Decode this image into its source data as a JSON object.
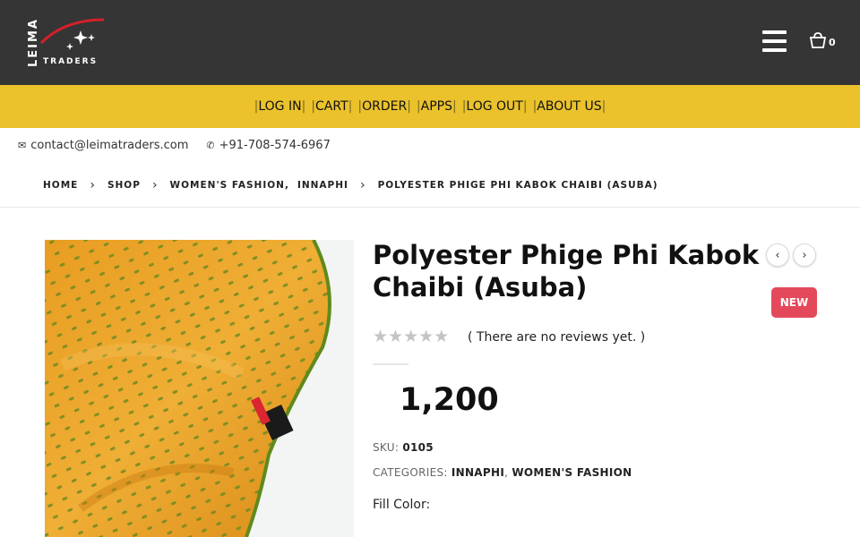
{
  "header": {
    "logo_vertical": "LEIMA",
    "logo_subtitle": "TRADERS",
    "cart_count": "0"
  },
  "nav": {
    "items": [
      {
        "label": "LOG IN"
      },
      {
        "label": "CART"
      },
      {
        "label": "ORDER"
      },
      {
        "label": "APPS"
      },
      {
        "label": "LOG OUT"
      },
      {
        "label": "ABOUT US"
      }
    ],
    "bar_color": "#ebc22b"
  },
  "contact": {
    "email": "contact@leimatraders.com",
    "phone": "+91-708-574-6967"
  },
  "breadcrumb": {
    "home": "HOME",
    "shop": "SHOP",
    "cat1": "WOMEN'S FASHION,",
    "cat2": "INNAPHI",
    "current": "POLYESTER PHIGE PHI KABOK CHAIBI (ASUBA)"
  },
  "product": {
    "title": "Polyester Phige Phi Kabok Chaibi (Asuba)",
    "badge": "NEW",
    "rating": 0,
    "reviews_text": "( There are no reviews yet. )",
    "price": "1,200",
    "sku_label": "SKU:",
    "sku_value": "0105",
    "categories_label": "CATEGORIES:",
    "category_1": "INNAPHI",
    "category_sep": ",",
    "category_2": "WOMEN'S FASHION",
    "fill_color_label": "Fill Color:"
  },
  "icons": {
    "email": "envelope-icon",
    "phone": "whatsapp-icon",
    "cart": "shopping-bag-icon",
    "menu": "hamburger-menu-icon",
    "prev": "chevron-left-icon",
    "next": "chevron-right-icon"
  },
  "colors": {
    "header_bg": "#353535",
    "badge_new": "#e4495b",
    "fabric": "#e8a12a"
  }
}
